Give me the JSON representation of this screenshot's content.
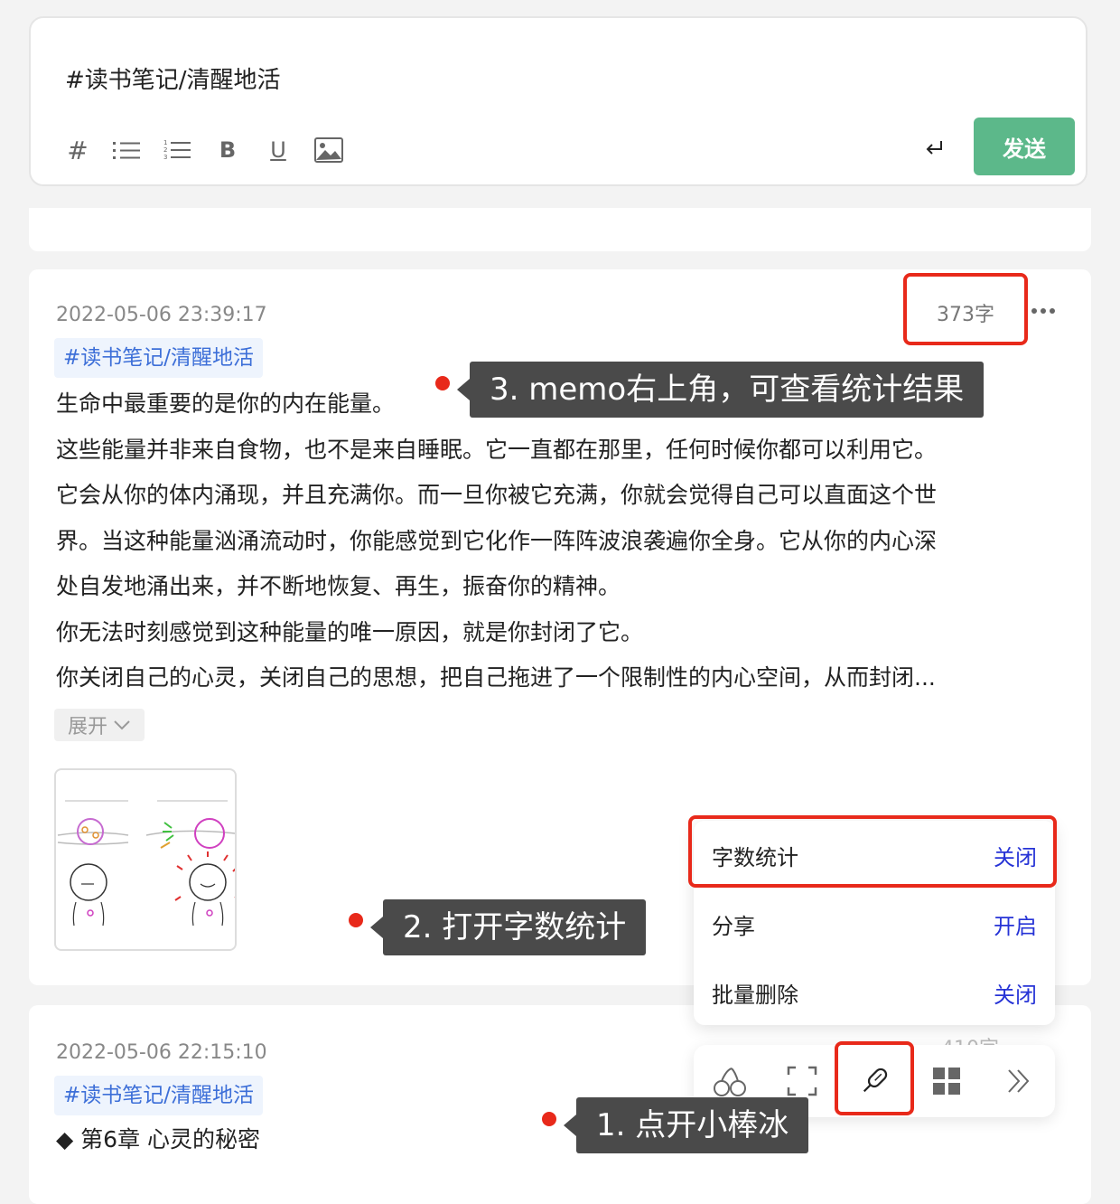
{
  "editor": {
    "content": "#读书笔记/清醒地活",
    "send_label": "发送",
    "toolbar": {
      "hash": "#",
      "bold": "B",
      "underline": "U"
    }
  },
  "memo1": {
    "timestamp": "2022-05-06 23:39:17",
    "word_count": "373字",
    "tag": "#读书笔记/清醒地活",
    "lines": [
      "生命中最重要的是你的内在能量。",
      "这些能量并非来自食物，也不是来自睡眠。它一直都在那里，任何时候你都可以利用它。",
      "它会从你的体内涌现，并且充满你。而一旦你被它充满，你就会觉得自己可以直面这个世",
      "界。当这种能量汹涌流动时，你能感觉到它化作一阵阵波浪袭遍你全身。它从你的内心深",
      "处自发地涌出来，并不断地恢复、再生，振奋你的精神。",
      "你无法时刻感觉到这种能量的唯一原因，就是你封闭了它。",
      "你关闭自己的心灵，关闭自己的思想，把自己拖进了一个限制性的内心空间，从而封闭..."
    ],
    "expand_label": "展开"
  },
  "memo2": {
    "timestamp": "2022-05-06 22:15:10",
    "word_count_partial": "410字",
    "tag": "#读书笔记/清醒地活",
    "first_line": "◆ 第6章 心灵的秘密"
  },
  "menu": {
    "items": [
      {
        "label": "字数统计",
        "value": "关闭"
      },
      {
        "label": "分享",
        "value": "开启"
      },
      {
        "label": "批量删除",
        "value": "关闭"
      }
    ]
  },
  "callouts": {
    "step1": "1. 点开小棒冰",
    "step2": "2. 打开字数统计",
    "step3": "3. memo右上角，可查看统计结果"
  },
  "colors": {
    "accent_green": "#5cb88a",
    "tag_blue": "#3d6fd8",
    "menu_value_blue": "#2633d6",
    "highlight_red": "#e8291a",
    "callout_bg": "#4a4a4a"
  }
}
